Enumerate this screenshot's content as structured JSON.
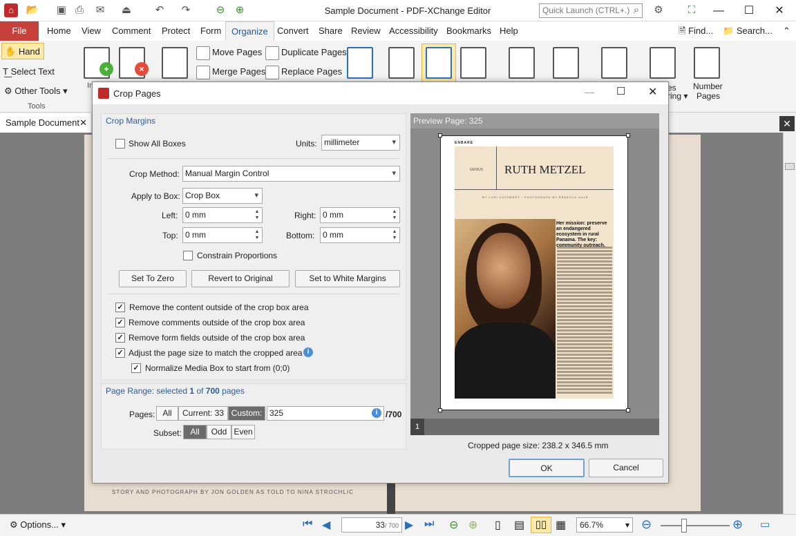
{
  "app": {
    "window_title": "Sample Document - PDF-XChange Editor",
    "quick_launch_placeholder": "Quick Launch (CTRL+.)",
    "menu": [
      "File",
      "Home",
      "View",
      "Comment",
      "Protect",
      "Form",
      "Organize",
      "Convert",
      "Share",
      "Review",
      "Accessibility",
      "Bookmarks",
      "Help"
    ],
    "find_label": "Find...",
    "search_label": "Search..."
  },
  "ribbon": {
    "hand": "Hand",
    "select_text": "Select Text",
    "other_tools": "Other Tools",
    "tools_group": "Tools",
    "move_pages": "Move Pages",
    "merge_pages": "Merge Pages",
    "duplicate_pages": "Duplicate Pages",
    "replace_pages": "Replace Pages",
    "number_pages_1": "Number",
    "number_pages_2": "Pages",
    "partial_in": "In",
    "partial_es": "es",
    "partial_ring": "ring"
  },
  "document_tab": "Sample Document",
  "page_caption": "STORY AND PHOTOGRAPH BY JON GOLDEN AS TOLD TO NINA STROCHLIC",
  "dialog": {
    "title": "Crop Pages",
    "crop_margins_section": "Crop Margins",
    "show_all_boxes": "Show All Boxes",
    "units_label": "Units:",
    "units_value": "millimeter",
    "crop_method_label": "Crop Method:",
    "crop_method_value": "Manual Margin Control",
    "apply_to_box_label": "Apply to Box:",
    "apply_to_box_value": "Crop Box",
    "left_label": "Left:",
    "left_value": "0 mm",
    "right_label": "Right:",
    "right_value": "0 mm",
    "top_label": "Top:",
    "top_value": "0 mm",
    "bottom_label": "Bottom:",
    "bottom_value": "0 mm",
    "constrain_proportions": "Constrain Proportions",
    "set_to_zero": "Set To Zero",
    "revert_to_original": "Revert to Original",
    "set_to_white_margins": "Set to White Margins",
    "options": [
      "Remove the content outside of the crop box area",
      "Remove comments outside of the crop box area",
      "Remove form fields outside of the crop box area",
      "Adjust the page size to match the cropped area"
    ],
    "normalize_media_box": "Normalize Media Box to start from (0;0)",
    "page_range_prefix": "Page Range: selected ",
    "page_range_selected": "1",
    "page_range_of": " of ",
    "page_range_total": "700",
    "page_range_suffix": " pages",
    "pages_label": "Pages:",
    "seg_all": "All",
    "seg_current": "Current: 33",
    "seg_custom": "Custom:",
    "custom_value": "325",
    "page_total_suffix": "/700",
    "subset_label": "Subset:",
    "subset_all": "All",
    "subset_odd": "Odd",
    "subset_even": "Even",
    "preview_title": "Preview Page: 325",
    "preview_page_index": "1",
    "cropped_size": "Cropped page size: 238.2 x 346.5 mm",
    "ok": "OK",
    "cancel": "Cancel"
  },
  "preview_article": {
    "kicker": "ENBARE",
    "section": "GENIUS",
    "name": "RUTH METZEL",
    "byline": "BY LORI CUTHBERT · PHOTOGRAPH BY REBECCA HALE",
    "headline": "Her mission: preserve an endangered ecosystem in rural Panama. The key: community outreach."
  },
  "statusbar": {
    "options": "Options...",
    "page_current": "33",
    "page_total": "/ 700",
    "zoom": "66.7%"
  }
}
